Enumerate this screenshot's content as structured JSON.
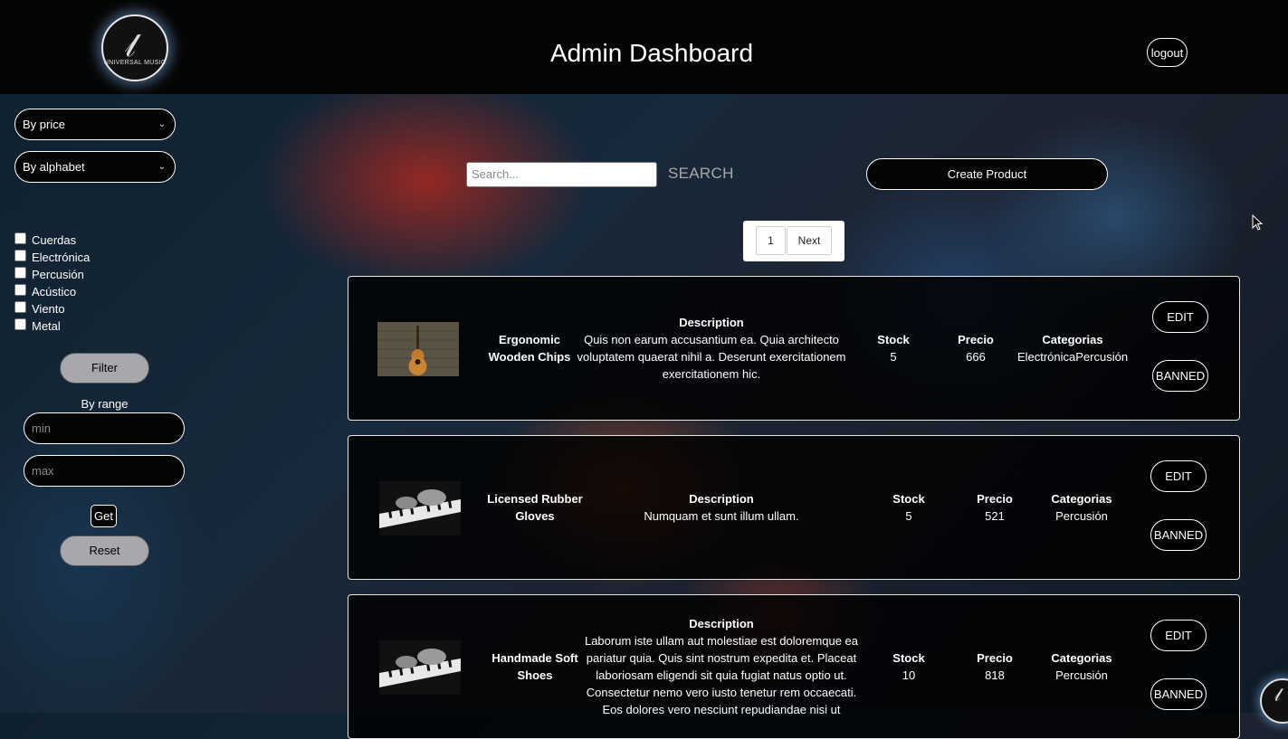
{
  "header": {
    "title": "Admin Dashboard",
    "logo_text": "UNIVERSAL MUSIC",
    "logout_label": "logout"
  },
  "sidebar": {
    "sort_price": "By price",
    "sort_alpha": "By alphabet",
    "categories": [
      {
        "label": "Cuerdas",
        "checked": false
      },
      {
        "label": "Electrónica",
        "checked": false
      },
      {
        "label": "Percusión",
        "checked": false
      },
      {
        "label": "Acústico",
        "checked": false
      },
      {
        "label": "Viento",
        "checked": false
      },
      {
        "label": "Metal",
        "checked": false
      }
    ],
    "filter_label": "Filter",
    "range_label": "By range",
    "min_placeholder": "min",
    "max_placeholder": "max",
    "get_label": "Get",
    "reset_label": "Reset"
  },
  "toolbar": {
    "search_placeholder": "Search...",
    "search_label": "SEARCH",
    "create_label": "Create Product"
  },
  "pagination": {
    "current_page": "1",
    "next_label": "Next"
  },
  "columns": {
    "description": "Description",
    "stock": "Stock",
    "price": "Precio",
    "categories": "Categorias"
  },
  "products": [
    {
      "name": "Ergonomic Wooden Chips",
      "description": "Quis non earum accusantium ea. Quia architecto voluptatem quaerat nihil a. Deserunt exercitationem exercitationem hic.",
      "stock": "5",
      "price": "666",
      "categories": "ElectrónicaPercusión",
      "image": "guitar",
      "edit_label": "EDIT",
      "banned_label": "BANNED"
    },
    {
      "name": "Licensed Rubber Gloves",
      "description": "Numquam et sunt illum ullam.",
      "stock": "5",
      "price": "521",
      "categories": "Percusión",
      "image": "piano",
      "edit_label": "EDIT",
      "banned_label": "BANNED"
    },
    {
      "name": "Handmade Soft Shoes",
      "description": "Laborum iste ullam aut molestiae est doloremque ea pariatur quia. Quis sint nostrum expedita et. Placeat laboriosam eligendi sit quia fugiat natus optio ut. Consectetur nemo vero iusto tenetur rem occaecati. Eos dolores vero nesciunt repudiandae nisi ut",
      "stock": "10",
      "price": "818",
      "categories": "Percusión",
      "image": "piano",
      "edit_label": "EDIT",
      "banned_label": "BANNED"
    }
  ],
  "colors": {
    "header_bg": "#050505",
    "button_grey": "#a6a8ad",
    "card_bg": "#000000"
  },
  "icons": [
    "logo-icon",
    "chevron-down-icon",
    "cursor-icon",
    "guitar-image",
    "piano-image"
  ]
}
